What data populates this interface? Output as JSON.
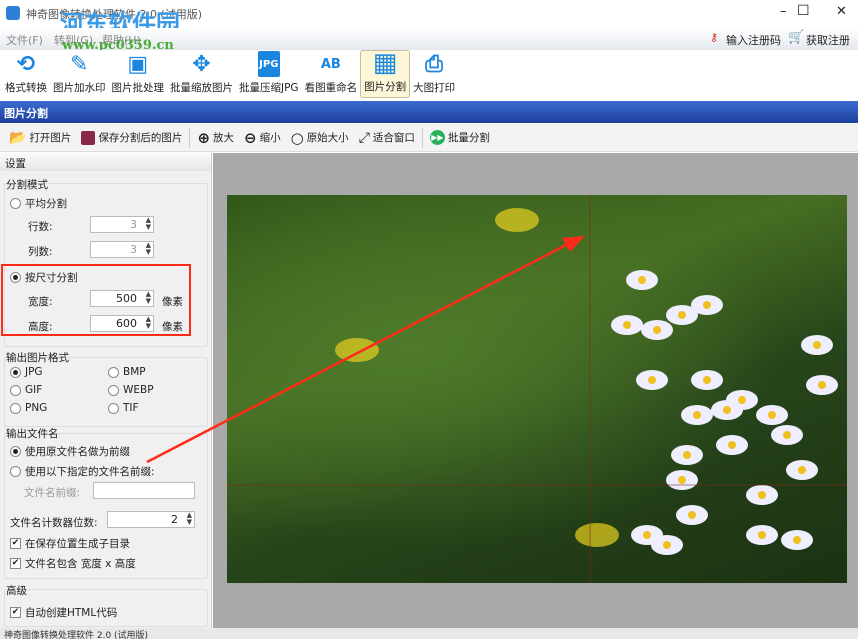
{
  "window": {
    "title": "神奇图像转换处理软件 2.0 (试用版)",
    "minimize": "–",
    "maximize": "☐",
    "close": "✕"
  },
  "watermark": {
    "name": "河东软件园",
    "url": "www.pc0359.cn"
  },
  "menu": [
    "文件(F)",
    "转到(G)",
    "帮助(H)"
  ],
  "register": {
    "enter": "输入注册码",
    "get": "获取注册码"
  },
  "toolbar": [
    {
      "label": "格式转换",
      "icon": "⟲"
    },
    {
      "label": "图片加水印",
      "icon": "✎"
    },
    {
      "label": "图片批处理",
      "icon": "▣"
    },
    {
      "label": "批量缩放图片",
      "icon": "✥"
    },
    {
      "label": "批量压缩JPG",
      "icon": "JPG"
    },
    {
      "label": "看图重命名",
      "icon": "AB"
    },
    {
      "label": "图片分割",
      "icon": "▦"
    },
    {
      "label": "大图打印",
      "icon": "⎙"
    }
  ],
  "section_title": "图片分割",
  "toolbar2": [
    "打开图片",
    "保存分割后的图片",
    "放大",
    "缩小",
    "原始大小",
    "适合窗口",
    "批量分割"
  ],
  "settings": {
    "title": "设置",
    "split_mode": {
      "label": "分割模式",
      "even": "平均分割",
      "rows_label": "行数:",
      "rows": "3",
      "cols_label": "列数:",
      "cols": "3",
      "by_size": "按尺寸分割",
      "width_label": "宽度:",
      "width": "500",
      "height_label": "高度:",
      "height": "600",
      "unit": "像素"
    },
    "format": {
      "label": "输出图片格式",
      "options": [
        "JPG",
        "BMP",
        "GIF",
        "WEBP",
        "PNG",
        "TIF"
      ],
      "selected": "JPG"
    },
    "filename": {
      "label": "输出文件名",
      "use_original": "使用原文件名做为前缀",
      "use_custom": "使用以下指定的文件名前缀:",
      "prefix_label": "文件名前缀:",
      "prefix": "",
      "counter_label": "文件名计数器位数:",
      "counter": "2",
      "subdir": "在保存位置生成子目录",
      "include_size": "文件名包含 宽度 x 高度"
    },
    "advanced": {
      "label": "高级",
      "html": "自动创建HTML代码"
    }
  },
  "status": "神奇图像转换处理软件 2.0 (试用版)",
  "colors": {
    "accent": "#1a86e0",
    "highlight": "#ff2a1a",
    "header": "#2a4fb0"
  }
}
